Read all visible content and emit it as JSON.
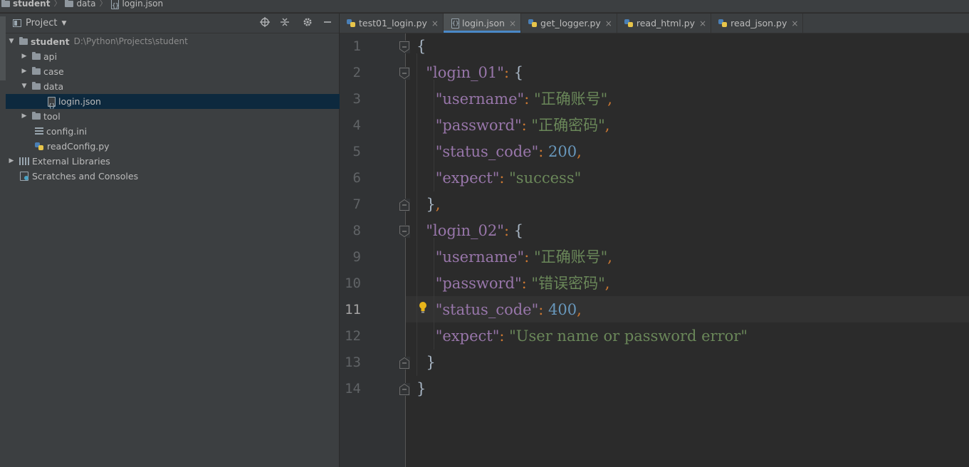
{
  "breadcrumb": [
    "student",
    "data",
    "login.json"
  ],
  "project_panel": {
    "title": "Project",
    "tree": [
      {
        "label": "student",
        "path": "D:\\Python\\Projects\\student",
        "level": 0,
        "state": "expanded",
        "icon": "folder-icon",
        "bold": true
      },
      {
        "label": "api",
        "level": 1,
        "state": "collapsed",
        "icon": "folder-icon"
      },
      {
        "label": "case",
        "level": 1,
        "state": "collapsed",
        "icon": "folder-icon"
      },
      {
        "label": "data",
        "level": 1,
        "state": "expanded",
        "icon": "folder-icon"
      },
      {
        "label": "login.json",
        "level": 2,
        "state": "leaf",
        "icon": "json-file-icon",
        "selected": true
      },
      {
        "label": "tool",
        "level": 1,
        "state": "collapsed",
        "icon": "folder-icon"
      },
      {
        "label": "config.ini",
        "level": 1,
        "state": "leaf",
        "icon": "ini-file-icon"
      },
      {
        "label": "readConfig.py",
        "level": 1,
        "state": "leaf",
        "icon": "python-file-icon"
      },
      {
        "label": "External Libraries",
        "level": 0,
        "state": "collapsed",
        "icon": "library-icon"
      },
      {
        "label": "Scratches and Consoles",
        "level": 0,
        "state": "leaf",
        "icon": "scratch-icon"
      }
    ]
  },
  "editor": {
    "tabs": [
      {
        "label": "test01_login.py",
        "icon": "python-file-icon",
        "active": false
      },
      {
        "label": "login.json",
        "icon": "json-file-icon",
        "active": true
      },
      {
        "label": "get_logger.py",
        "icon": "python-file-icon",
        "active": false
      },
      {
        "label": "read_html.py",
        "icon": "python-file-icon",
        "active": false
      },
      {
        "label": "read_json.py",
        "icon": "python-file-icon",
        "active": false
      }
    ],
    "current_line": 11,
    "lines": [
      [
        {
          "t": "{",
          "c": "b"
        }
      ],
      [
        {
          "t": "  ",
          "c": "b"
        },
        {
          "t": "\"login_01\"",
          "c": "k"
        },
        {
          "t": ": ",
          "c": "p"
        },
        {
          "t": "{",
          "c": "b"
        }
      ],
      [
        {
          "t": "    ",
          "c": "b"
        },
        {
          "t": "\"username\"",
          "c": "k"
        },
        {
          "t": ": ",
          "c": "p"
        },
        {
          "t": "\"正确账号\"",
          "c": "s"
        },
        {
          "t": ",",
          "c": "p"
        }
      ],
      [
        {
          "t": "    ",
          "c": "b"
        },
        {
          "t": "\"password\"",
          "c": "k"
        },
        {
          "t": ": ",
          "c": "p"
        },
        {
          "t": "\"正确密码\"",
          "c": "s"
        },
        {
          "t": ",",
          "c": "p"
        }
      ],
      [
        {
          "t": "    ",
          "c": "b"
        },
        {
          "t": "\"status_code\"",
          "c": "k"
        },
        {
          "t": ": ",
          "c": "p"
        },
        {
          "t": "200",
          "c": "n"
        },
        {
          "t": ",",
          "c": "p"
        }
      ],
      [
        {
          "t": "    ",
          "c": "b"
        },
        {
          "t": "\"expect\"",
          "c": "k"
        },
        {
          "t": ": ",
          "c": "p"
        },
        {
          "t": "\"success\"",
          "c": "s"
        }
      ],
      [
        {
          "t": "  ",
          "c": "b"
        },
        {
          "t": "}",
          "c": "b"
        },
        {
          "t": ",",
          "c": "p"
        }
      ],
      [
        {
          "t": "  ",
          "c": "b"
        },
        {
          "t": "\"login_02\"",
          "c": "k"
        },
        {
          "t": ": ",
          "c": "p"
        },
        {
          "t": "{",
          "c": "b"
        }
      ],
      [
        {
          "t": "    ",
          "c": "b"
        },
        {
          "t": "\"username\"",
          "c": "k"
        },
        {
          "t": ": ",
          "c": "p"
        },
        {
          "t": "\"正确账号\"",
          "c": "s"
        },
        {
          "t": ",",
          "c": "p"
        }
      ],
      [
        {
          "t": "    ",
          "c": "b"
        },
        {
          "t": "\"password\"",
          "c": "k"
        },
        {
          "t": ": ",
          "c": "p"
        },
        {
          "t": "\"错误密码\"",
          "c": "s"
        },
        {
          "t": ",",
          "c": "p"
        }
      ],
      [
        {
          "t": "    ",
          "c": "b"
        },
        {
          "t": "\"status_code\"",
          "c": "k"
        },
        {
          "t": ": ",
          "c": "p"
        },
        {
          "t": "400",
          "c": "n"
        },
        {
          "t": ",",
          "c": "p"
        }
      ],
      [
        {
          "t": "    ",
          "c": "b"
        },
        {
          "t": "\"expect\"",
          "c": "k"
        },
        {
          "t": ": ",
          "c": "p"
        },
        {
          "t": "\"User name or password error\"",
          "c": "s"
        }
      ],
      [
        {
          "t": "  ",
          "c": "b"
        },
        {
          "t": "}",
          "c": "b"
        }
      ],
      [
        {
          "t": "}",
          "c": "b"
        }
      ]
    ]
  },
  "colors": {
    "key": "#9876aa",
    "string": "#6a8759",
    "number": "#6897bb",
    "punct": "#cc7832",
    "brace": "#a9b7c6",
    "selection": "#0d293e",
    "accent": "#4a88c7"
  }
}
